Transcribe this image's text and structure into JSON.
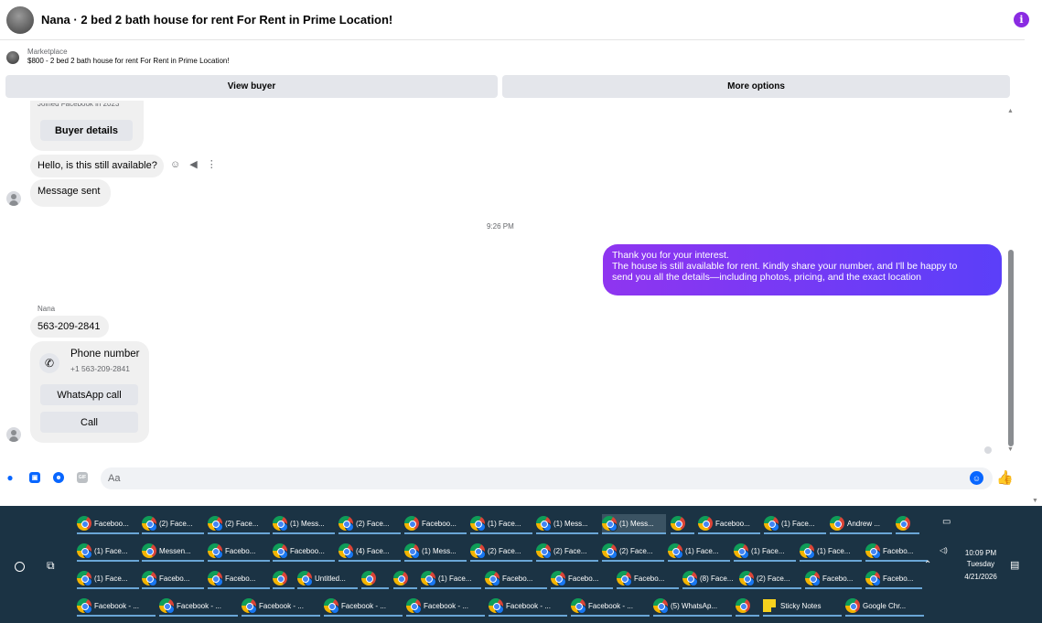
{
  "header": {
    "title": "Nana · 2 bed 2 bath house for rent For Rent in Prime Location!",
    "info_icon": "i"
  },
  "marketplace": {
    "label": "Marketplace",
    "listing": "$800 - 2 bed 2 bath house for rent For Rent in Prime Location!"
  },
  "actions": {
    "view_buyer": "View buyer",
    "more_options": "More options"
  },
  "chat": {
    "joined_text": "Joined Facebook in 2023",
    "buyer_details": "Buyer details",
    "msg_available": "Hello, is this still available?",
    "msg_sent": "Message sent",
    "timestamp": "9:26 PM",
    "outgoing_lines": [
      "Thank you for your interest.",
      "The house is still available for rent. Kindly share your number, and I'll be happy to",
      "send you all the details—including photos, pricing, and the exact location"
    ],
    "sender_name": "Nana",
    "phone_text": "563-209-2841",
    "phone_card": {
      "title": "Phone number",
      "number": "+1 563-209-2841",
      "whatsapp": "WhatsApp call",
      "call": "Call"
    }
  },
  "composer": {
    "placeholder": "Aa",
    "gif_label": "GIF"
  },
  "taskbar": {
    "rows": [
      [
        "Faceboo...",
        "(2) Face...",
        "(2) Face...",
        "(1) Mess...",
        "(2) Face...",
        "Faceboo...",
        "(1) Face...",
        "(1) Mess...",
        "(1) Mess...",
        "",
        "Faceboo...",
        "(1) Face...",
        "Andrew ...",
        ""
      ],
      [
        "(1) Face...",
        "Messen...",
        "Facebo...",
        "Faceboo...",
        "(4) Face...",
        "(1) Mess...",
        "(2) Face...",
        "(2) Face...",
        "(2) Face...",
        "(1) Face...",
        "(1) Face...",
        "(1) Face...",
        "Facebo..."
      ],
      [
        "(1) Face...",
        "Facebo...",
        "Facebo...",
        "",
        "Untitled...",
        "",
        "",
        "(1) Face...",
        "Facebo...",
        "Facebo...",
        "Facebo...",
        "(8) Face...",
        "(2) Face...",
        "Facebo...",
        "Facebo..."
      ],
      [
        "Facebook - ...",
        "Facebook - ...",
        "Facebook - ...",
        "Facebook - ...",
        "Facebook - ...",
        "Facebook - ...",
        "Facebook - ...",
        "(5) WhatsAp...",
        "",
        "Sticky Notes",
        "Google Chr..."
      ]
    ],
    "time": "10:09 PM",
    "day": "Tuesday",
    "date": "4/21/2026"
  }
}
